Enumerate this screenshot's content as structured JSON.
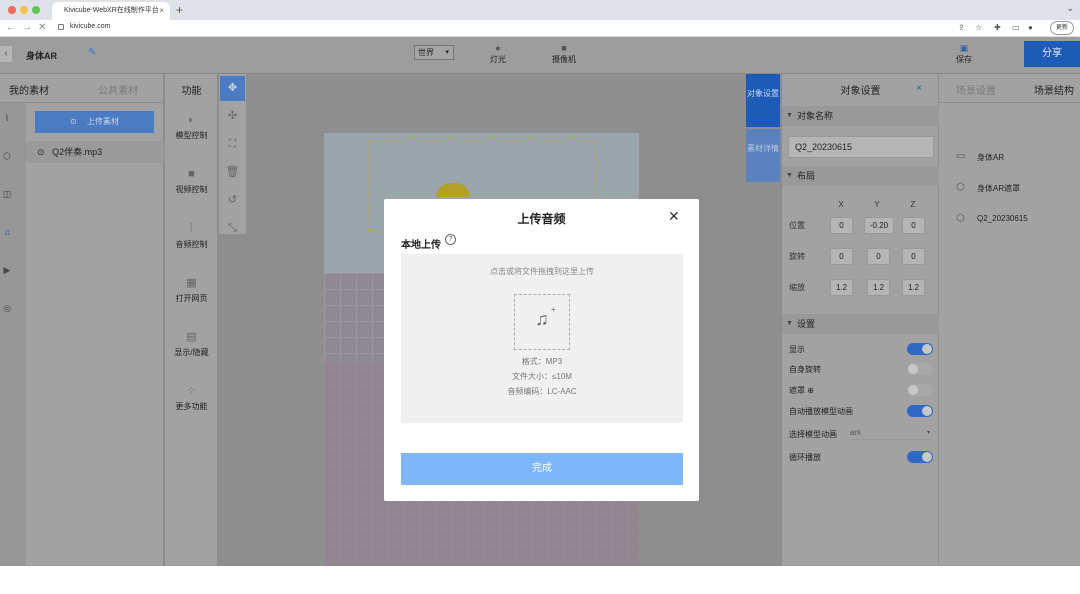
{
  "browser": {
    "tab_title": "Kivicube-WebXR在线制作平台",
    "tab_close": "×",
    "new_tab": "+",
    "url": "kivicube.com",
    "update_label": "更新",
    "tabs_menu": "⌄",
    "nav_back": "←",
    "nav_forward": "→",
    "reload": "✕"
  },
  "topbar": {
    "back": "‹",
    "project_name": "身体AR",
    "world_select": "世界",
    "world_caret": "▾",
    "light_label": "灯光",
    "camera_label": "摄像机",
    "save_label": "保存",
    "share_label": "分享"
  },
  "left_panel": {
    "tab_mine": "我的素材",
    "tab_public": "公共素材",
    "upload_button": "上传素材",
    "file_item": "Q2伴奏.mp3",
    "rail_icons": [
      "chart-icon",
      "cube-icon",
      "ar-icon",
      "music-icon",
      "video-icon",
      "panorama-icon"
    ]
  },
  "functions": {
    "header": "功能",
    "items": [
      "模型控制",
      "视频控制",
      "音频控制",
      "打开网页",
      "显示/隐藏",
      "更多功能"
    ]
  },
  "tools": [
    "move-icon",
    "rotate-icon",
    "scale-icon",
    "delete-icon",
    "undo-icon",
    "fullscreen-icon"
  ],
  "side_tabs": {
    "object_settings": "对象设置",
    "material_details": "素材详情"
  },
  "object_panel": {
    "title": "对象设置",
    "close": "×",
    "name_section": "对象名称",
    "name_value": "Q2_20230615",
    "layout_section": "布局",
    "axes": [
      "X",
      "Y",
      "Z"
    ],
    "rows": [
      {
        "label": "位置",
        "values": [
          "0",
          "-0.20",
          "0"
        ]
      },
      {
        "label": "旋转",
        "values": [
          "0",
          "0",
          "0"
        ]
      },
      {
        "label": "缩放",
        "values": [
          "1.2",
          "1.2",
          "1.2"
        ]
      }
    ],
    "settings_section": "设置",
    "settings": [
      {
        "label": "显示",
        "on": true
      },
      {
        "label": "自身旋转",
        "on": false
      },
      {
        "label": "遮罩",
        "on": false
      },
      {
        "label": "自动播放模型动画",
        "on": true
      },
      {
        "label": "循环播放",
        "on": true
      }
    ],
    "anim_label": "选择模型动画",
    "anim_value": "ani",
    "mask_info": "⊕"
  },
  "scene_panel": {
    "tab_scene_settings": "场景设置",
    "tab_scene_structure": "场景结构",
    "items": [
      "身体AR",
      "身体AR遮罩",
      "Q2_20230615"
    ]
  },
  "modal": {
    "title": "上传音频",
    "close": "✕",
    "subtitle": "本地上传",
    "help": "?",
    "drop_hint": "点击或将文件拖拽到这里上传",
    "format": "格式：MP3",
    "size": "文件大小：≤10M",
    "codec": "音频编码：LC-AAC",
    "done": "完成"
  },
  "colors": {
    "accent": "#1c5bb8",
    "done_button": "#7db6f9",
    "toggle_on": "#2f68c5"
  }
}
